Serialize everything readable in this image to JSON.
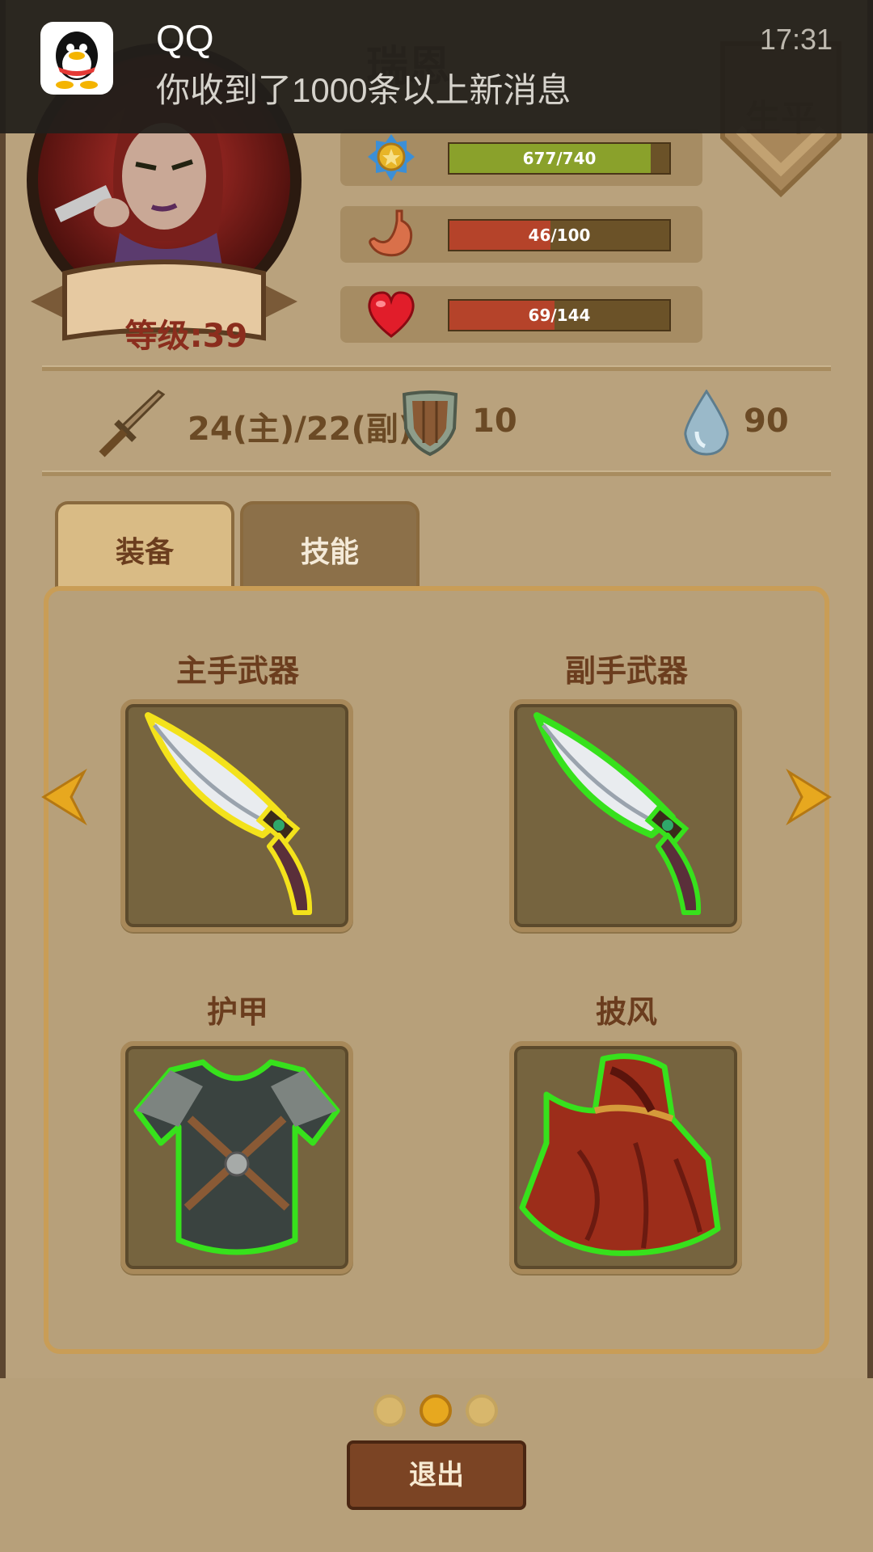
{
  "notification": {
    "app": "QQ",
    "message": "你收到了1000条以上新消息",
    "time": "17:31"
  },
  "header": {
    "hero_name": "瑞恩",
    "lifetime_label": "生平",
    "level_label": "等级:39"
  },
  "bars": [
    {
      "icon": "medal-icon",
      "text": "677/740",
      "fraction": 0.915,
      "color": "#8aa12b"
    },
    {
      "icon": "stomach-icon",
      "text": "46/100",
      "fraction": 0.46,
      "color": "#b5432a"
    },
    {
      "icon": "heart-icon",
      "text": "69/144",
      "fraction": 0.479,
      "color": "#b5432a"
    }
  ],
  "stats": {
    "attack": "24(主)/22(副)",
    "defense": "10",
    "water": "90"
  },
  "tabs": [
    {
      "label": "装备",
      "active": true
    },
    {
      "label": "技能",
      "active": false
    }
  ],
  "slots": [
    {
      "title": "主手武器",
      "item": "dagger-icon",
      "glow": "#f3e21b"
    },
    {
      "title": "副手武器",
      "item": "dagger-icon",
      "glow": "#37e11c"
    },
    {
      "title": "护甲",
      "item": "armor-icon",
      "glow": "#37e11c"
    },
    {
      "title": "披风",
      "item": "cloak-icon",
      "glow": "#37e11c"
    }
  ],
  "pager": {
    "pages": 3,
    "current": 2
  },
  "exit_label": "退出"
}
